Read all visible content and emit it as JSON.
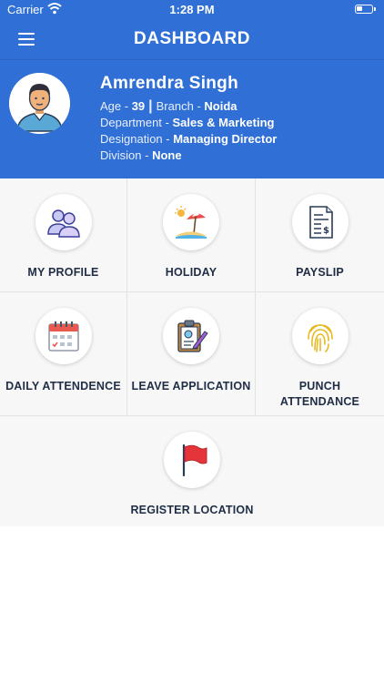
{
  "status_bar": {
    "carrier": "Carrier",
    "time": "1:28 PM"
  },
  "header": {
    "title": "DASHBOARD"
  },
  "profile": {
    "name": "Amrendra Singh",
    "age_label": "Age - ",
    "age": "39",
    "separator": "|",
    "branch_label": "Branch - ",
    "branch": "Noida",
    "department_label": "Department - ",
    "department": "Sales & Marketing",
    "designation_label": "Designation - ",
    "designation": "Managing Director",
    "division_label": "Division - ",
    "division": "None"
  },
  "menu": {
    "my_profile": "MY PROFILE",
    "holiday": "HOLIDAY",
    "payslip": "PAYSLIP",
    "daily_attendence": "DAILY ATTENDENCE",
    "leave_application": "LEAVE APPLICATION",
    "punch_line1": "PUNCH",
    "punch_line2": "ATTENDANCE",
    "register_location": "REGISTER LOCATION"
  },
  "icons": {
    "menu": "hamburger-icon",
    "avatar": "user-avatar-icon",
    "my_profile": "users-icon",
    "holiday": "beach-umbrella-icon",
    "payslip": "invoice-dollar-icon",
    "daily_attendence": "calendar-icon",
    "leave_application": "clipboard-pen-icon",
    "punch_attendance": "fingerprint-icon",
    "register_location": "red-flag-icon"
  },
  "colors": {
    "primary": "#2f6fd6",
    "label": "#1f2d45",
    "tile_bg": "#f7f7f8"
  }
}
